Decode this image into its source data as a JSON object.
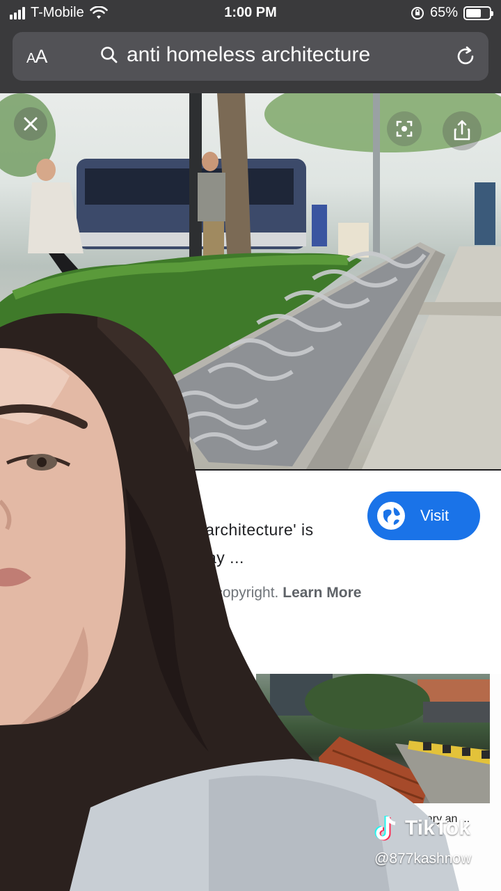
{
  "status_bar": {
    "carrier": "T-Mobile",
    "time": "1:00 PM",
    "battery_text": "65%",
    "battery_level": 0.65
  },
  "address_bar": {
    "text_size_label": "AA",
    "query": "anti homeless architecture"
  },
  "result_card": {
    "visit_label": "Visit",
    "title_line1": "nsive architecture' is",
    "title_line2": "say ...",
    "notice_prefix": "to copyright.",
    "learn_more": "Learn More"
  },
  "related": {
    "caption": "Calgary an ..."
  },
  "watermark": {
    "brand": "TikTok",
    "handle": "@877kashnow"
  },
  "colors": {
    "visit_button": "#1a73e8",
    "address_bar": "#525256",
    "top_chrome": "#3a3a3c"
  }
}
